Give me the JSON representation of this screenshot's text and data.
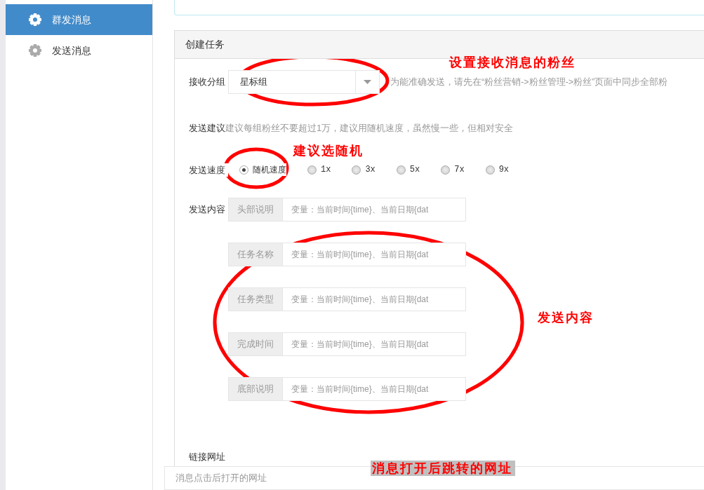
{
  "sidebar": {
    "items": [
      {
        "label": "群发消息",
        "selected": true
      },
      {
        "label": "发送消息",
        "selected": false
      }
    ]
  },
  "card": {
    "title": "创建任务"
  },
  "group": {
    "label": "接收分组",
    "value": "星标组",
    "hint": "为能准确发送，请先在“粉丝营销->粉丝管理->粉丝”页面中同步全部粉"
  },
  "advice": {
    "label": "发送建议",
    "text": "建议每组粉丝不要超过1万，建议用随机速度，虽然慢一些，但相对安全"
  },
  "speed": {
    "label": "发送速度",
    "options": [
      {
        "label": "随机速度",
        "selected": true
      },
      {
        "label": "1x",
        "selected": false
      },
      {
        "label": "3x",
        "selected": false
      },
      {
        "label": "5x",
        "selected": false
      },
      {
        "label": "7x",
        "selected": false
      },
      {
        "label": "9x",
        "selected": false
      }
    ]
  },
  "content": {
    "label": "发送内容",
    "fields": [
      {
        "addon": "头部说明",
        "placeholder": "变量：当前时间{time}、当前日期{dat"
      },
      {
        "addon": "任务名称",
        "placeholder": "变量：当前时间{time}、当前日期{dat"
      },
      {
        "addon": "任务类型",
        "placeholder": "变量：当前时间{time}、当前日期{dat"
      },
      {
        "addon": "完成时间",
        "placeholder": "变量：当前时间{time}、当前日期{dat"
      },
      {
        "addon": "底部说明",
        "placeholder": "变量：当前时间{time}、当前日期{dat"
      }
    ]
  },
  "link": {
    "label": "链接网址",
    "placeholder": "消息点击后打开的网址"
  },
  "annotations": [
    {
      "kind": "ellipse"
    },
    {
      "kind": "ellipse"
    },
    {
      "kind": "ellipse"
    },
    {
      "kind": "note",
      "text": "设置接收消息的粉丝"
    },
    {
      "kind": "note",
      "text": "建议选随机"
    },
    {
      "kind": "note",
      "text": "发送内容"
    },
    {
      "kind": "boxed-note",
      "text": "消息打开后跳转的网址"
    }
  ]
}
